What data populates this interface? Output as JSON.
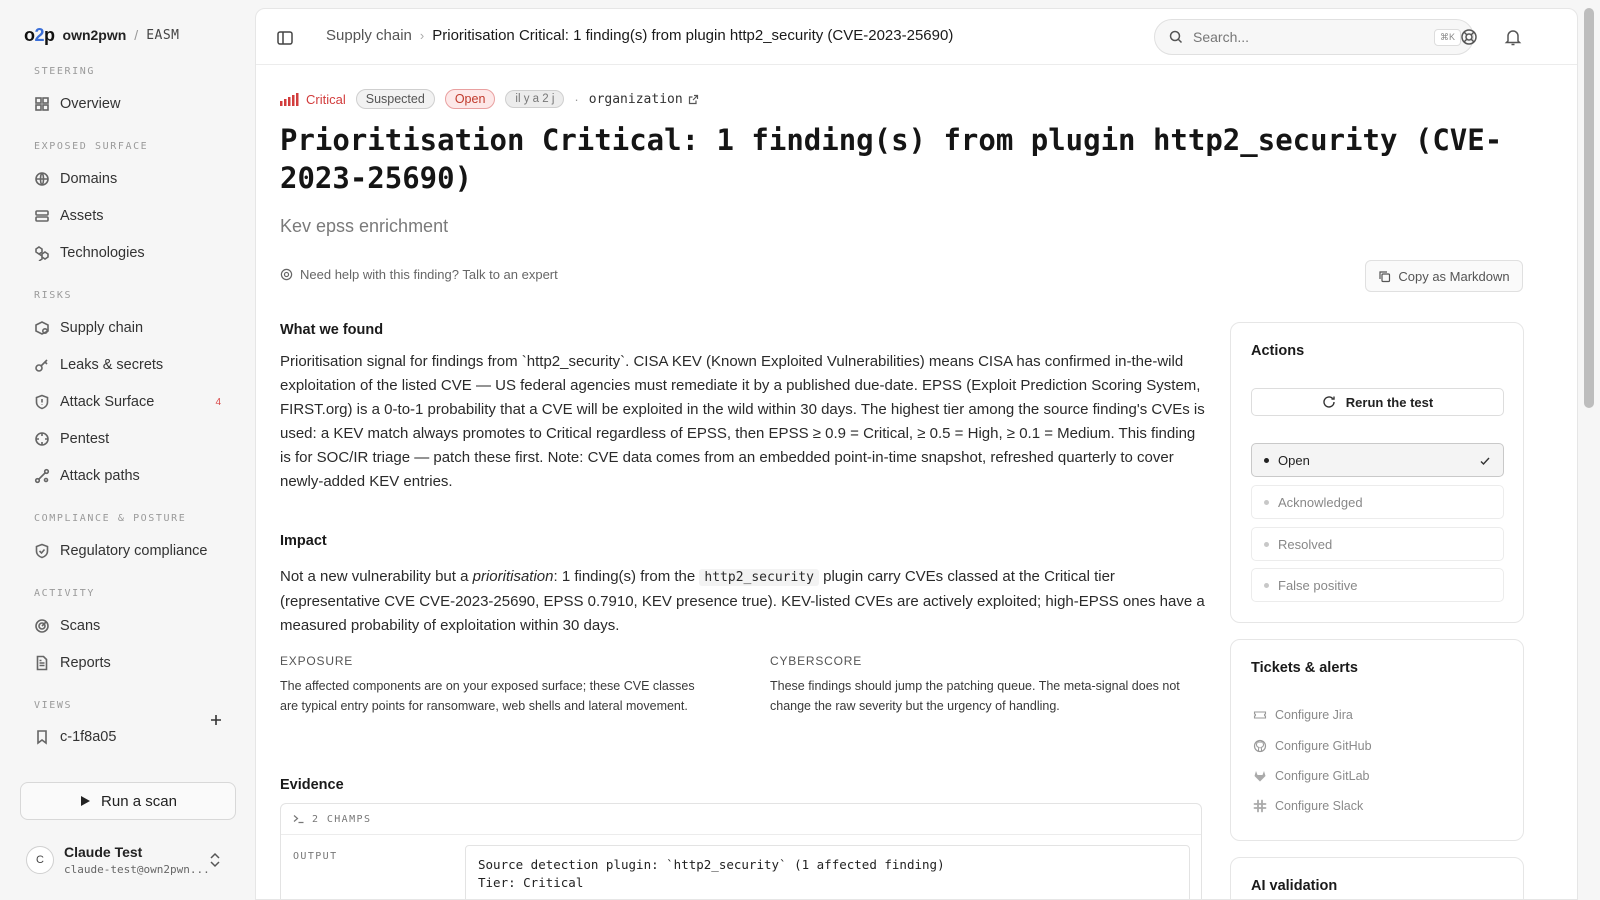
{
  "brand": {
    "logo_pre": "o",
    "logo_two": "2",
    "logo_post": "p",
    "org": "own2pwn",
    "separator": "/",
    "product": "EASM"
  },
  "sidebar": {
    "sections": {
      "steering": "STEERING",
      "exposed": "EXPOSED SURFACE",
      "risks": "RISKS",
      "compliance": "COMPLIANCE & POSTURE",
      "activity": "ACTIVITY",
      "views": "VIEWS"
    },
    "items": {
      "overview": "Overview",
      "domains": "Domains",
      "assets": "Assets",
      "technologies": "Technologies",
      "supply_chain": "Supply chain",
      "leaks": "Leaks & secrets",
      "attack_surface": "Attack Surface",
      "attack_surface_badge": "4",
      "pentest": "Pentest",
      "attack_paths": "Attack paths",
      "regulatory": "Regulatory compliance",
      "scans": "Scans",
      "reports": "Reports",
      "view_1": "c-1f8a05"
    },
    "run_scan": "Run a scan",
    "user": {
      "initial": "C",
      "name": "Claude Test",
      "email": "claude-test@own2pwn..."
    }
  },
  "topbar": {
    "breadcrumb_parent": "Supply chain",
    "breadcrumb_current": "Prioritisation Critical: 1 finding(s) from plugin http2_security (CVE-2023-25690)",
    "search_placeholder": "Search...",
    "search_shortcut": "⌘K"
  },
  "finding": {
    "severity": "Critical",
    "confidence": "Suspected",
    "status": "Open",
    "age": "il y a 2 j",
    "scope": "organization",
    "title": "Prioritisation Critical: 1 finding(s) from plugin http2_security (CVE-2023-25690)",
    "subtitle": "Kev epss enrichment",
    "help": "Need help with this finding? Talk to an expert",
    "copy_markdown": "Copy as Markdown"
  },
  "what_we_found": {
    "heading": "What we found",
    "text": "Prioritisation signal for findings from `http2_security`. CISA KEV (Known Exploited Vulnerabilities) means CISA has confirmed in-the-wild exploitation of the listed CVE — US federal agencies must remediate it by a published due-date. EPSS (Exploit Prediction Scoring System, FIRST.org) is a 0-to-1 probability that a CVE will be exploited in the wild within 30 days. The highest tier among the source finding's CVEs is used: a KEV match always promotes to Critical regardless of EPSS, then EPSS ≥ 0.9 = Critical, ≥ 0.5 = High, ≥ 0.1 = Medium. This finding is for SOC/IR triage — patch these first. Note: CVE data comes from an embedded point-in-time snapshot, refreshed quarterly to cover newly-added KEV entries."
  },
  "impact": {
    "heading": "Impact",
    "text_1": "Not a new vulnerability but a ",
    "text_em": "prioritisation",
    "text_2": ": 1 finding(s) from the ",
    "text_code": "http2_security",
    "text_3": " plugin carry CVEs classed at the Critical tier (representative CVE CVE-2023-25690, EPSS 0.7910, KEV presence true). KEV-listed CVEs are actively exploited; high-EPSS ones have a measured probability of exploitation within 30 days."
  },
  "exposure": {
    "label": "EXPOSURE",
    "text": "The affected components are on your exposed surface; these CVE classes are typical entry points for ransomware, web shells and lateral movement."
  },
  "cyberscore": {
    "label": "CYBERSCORE",
    "text": "These findings should jump the patching queue. The meta-signal does not change the raw severity but the urgency of handling."
  },
  "evidence": {
    "heading": "Evidence",
    "fields_label": "2 CHAMPS",
    "output_label": "OUTPUT",
    "output_text": "Source detection plugin: `http2_security` (1 affected finding)\nTier: Critical"
  },
  "actions": {
    "heading": "Actions",
    "rerun": "Rerun the test",
    "statuses": [
      "Open",
      "Acknowledged",
      "Resolved",
      "False positive"
    ]
  },
  "tickets": {
    "heading": "Tickets & alerts",
    "items": [
      "Configure Jira",
      "Configure GitHub",
      "Configure GitLab",
      "Configure Slack"
    ]
  },
  "next_card": {
    "heading": "AI validation"
  },
  "colors": {
    "critical": "#d23c3c",
    "accent": "#3b6fd8"
  }
}
